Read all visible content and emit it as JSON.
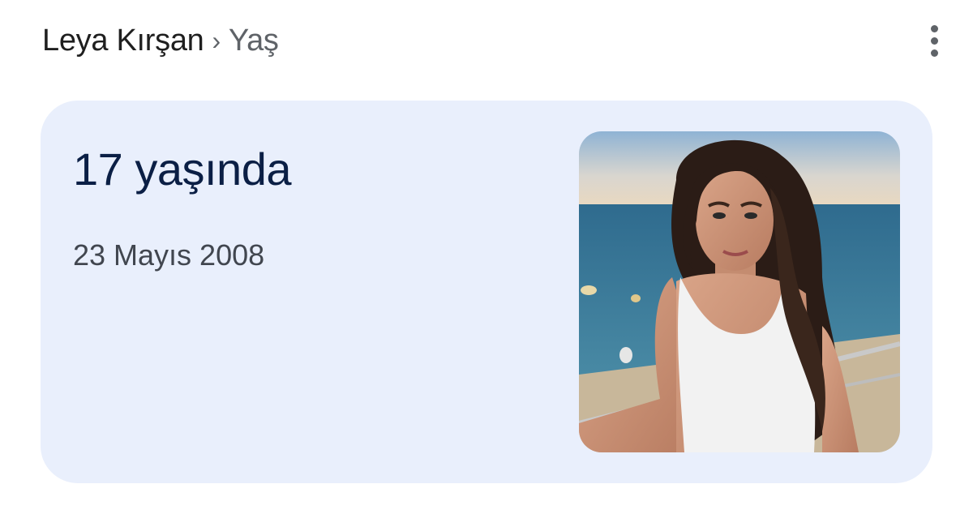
{
  "breadcrumb": {
    "entity": "Leya Kırşan",
    "separator": "›",
    "attribute": "Yaş"
  },
  "menu_icon": "more-vert-icon",
  "answer": {
    "age": "17 yaşında",
    "birth_date": "23 Mayıs 2008"
  },
  "colors": {
    "card_background": "#e9effc",
    "age_text": "#0b1f45",
    "secondary_text": "#5f6368"
  }
}
